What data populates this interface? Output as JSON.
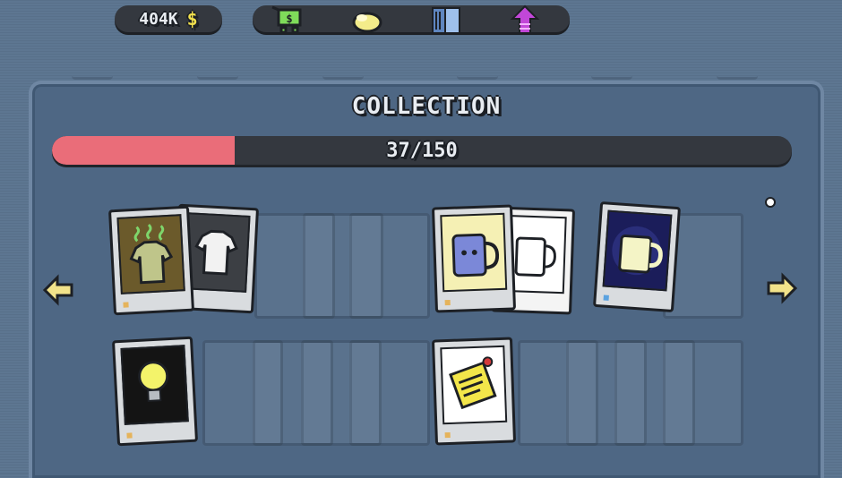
{
  "hud": {
    "money": "404K",
    "currency_symbol": "$",
    "tools": [
      {
        "name": "shop-cart",
        "color": "#7fdc5a"
      },
      {
        "name": "soap-bar",
        "color": "#f3ec8a"
      },
      {
        "name": "collection-book",
        "color": "#7aa2d8"
      },
      {
        "name": "upgrade-arrow",
        "color": "#c247d8"
      }
    ]
  },
  "panel": {
    "title": "COLLECTION",
    "progress_text": "37/150",
    "progress_current": 37,
    "progress_total": 150,
    "progress_color": "#ea6d79"
  },
  "nav": {
    "prev_icon": "arrow-left-icon",
    "next_icon": "arrow-right-icon",
    "arrow_color": "#f2e38a"
  },
  "sets": [
    {
      "name": "shirt",
      "unlocked_variants": [
        "dirty-shirt",
        "clean-shirt"
      ],
      "locked_count": 3
    },
    {
      "name": "mug",
      "unlocked_variants": [
        "blue-mug",
        "outline-mug",
        "night-mug"
      ],
      "locked_count": 1
    },
    {
      "name": "light-bulb",
      "unlocked_variants": [
        "glowing-bulb"
      ],
      "locked_count": 4
    },
    {
      "name": "sticky-note",
      "unlocked_variants": [
        "yellow-note"
      ],
      "locked_count": 4
    }
  ]
}
